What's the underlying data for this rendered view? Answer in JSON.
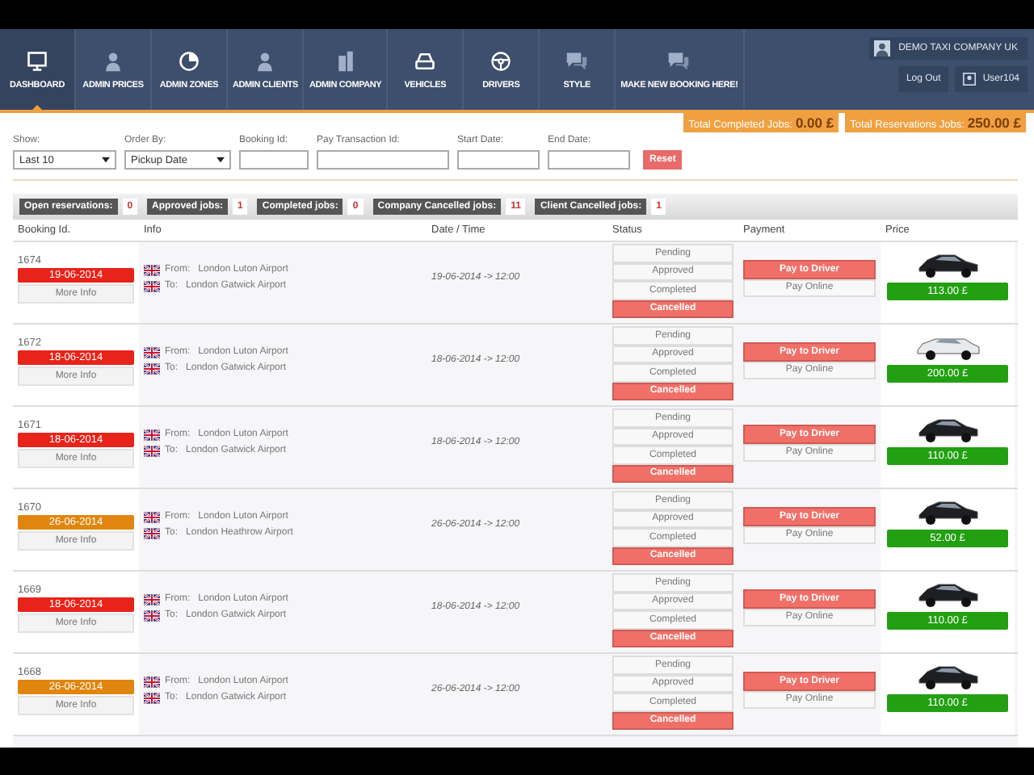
{
  "header": {
    "nav": [
      {
        "label": "DASHBOARD",
        "selected": true
      },
      {
        "label": "ADMIN PRICES",
        "selected": false
      },
      {
        "label": "ADMIN ZONES",
        "selected": false
      },
      {
        "label": "ADMIN CLIENTS",
        "selected": false
      },
      {
        "label": "ADMIN COMPANY",
        "selected": false
      },
      {
        "label": "VEHICLES",
        "selected": false
      },
      {
        "label": "DRIVERS",
        "selected": false
      },
      {
        "label": "STYLE",
        "selected": false
      },
      {
        "label": "MAKE NEW BOOKING HERE!",
        "selected": false
      }
    ],
    "company": "DEMO TAXI COMPANY UK",
    "logout": "Log Out",
    "user": "User104"
  },
  "totals": [
    {
      "label": "Total Completed Jobs:",
      "value": "0.00 £"
    },
    {
      "label": "Total Reservations Jobs:",
      "value": "250.00 £"
    }
  ],
  "filters": {
    "show": {
      "label": "Show:",
      "value": "Last 10"
    },
    "order_by": {
      "label": "Order By:",
      "value": "Pickup Date"
    },
    "booking_id": {
      "label": "Booking Id:"
    },
    "pay_transaction_id": {
      "label": "Pay Transaction Id:"
    },
    "start_date": {
      "label": "Start Date:"
    },
    "end_date": {
      "label": "End Date:"
    },
    "reset": "Reset"
  },
  "counts": [
    {
      "label": "Open reservations:",
      "value": "0"
    },
    {
      "label": "Approved jobs:",
      "value": "1"
    },
    {
      "label": "Completed jobs:",
      "value": "0"
    },
    {
      "label": "Company Cancelled jobs:",
      "value": "11"
    },
    {
      "label": "Client Cancelled jobs:",
      "value": "1"
    }
  ],
  "table": {
    "columns": [
      "Booking Id.",
      "Info",
      "Date / Time",
      "Status",
      "Payment",
      "Price"
    ],
    "rows": [
      {
        "id": "1674",
        "date": "19-06-2014",
        "color": "#e8231a",
        "more": "More Info",
        "from_label": "From:",
        "from": "London Luton Airport",
        "to_label": "To:",
        "to": "London Gatwick Airport",
        "datetime": "19-06-2014 -> 12:00",
        "statuses": [
          {
            "label": "Pending",
            "selected": false
          },
          {
            "label": "Approved",
            "selected": false
          },
          {
            "label": "Completed",
            "selected": false
          },
          {
            "label": "Cancelled",
            "selected": true
          }
        ],
        "payments": [
          {
            "label": "Pay to Driver",
            "selected": true
          },
          {
            "label": "Pay Online",
            "selected": false
          }
        ],
        "kind": "sedan",
        "price": "113.00 £"
      },
      {
        "id": "1672",
        "date": "18-06-2014",
        "color": "#e8231a",
        "more": "More Info",
        "from_label": "From:",
        "from": "London Luton Airport",
        "to_label": "To:",
        "to": "London Gatwick Airport",
        "datetime": "18-06-2014 -> 12:00",
        "statuses": [
          {
            "label": "Pending",
            "selected": false
          },
          {
            "label": "Approved",
            "selected": false
          },
          {
            "label": "Completed",
            "selected": false
          },
          {
            "label": "Cancelled",
            "selected": true
          }
        ],
        "payments": [
          {
            "label": "Pay to Driver",
            "selected": true
          },
          {
            "label": "Pay Online",
            "selected": false
          }
        ],
        "kind": "limousine",
        "price": "200.00 £"
      },
      {
        "id": "1671",
        "date": "18-06-2014",
        "color": "#e8231a",
        "more": "More Info",
        "from_label": "From:",
        "from": "London Luton Airport",
        "to_label": "To:",
        "to": "London Gatwick Airport",
        "datetime": "18-06-2014 -> 12:00",
        "statuses": [
          {
            "label": "Pending",
            "selected": false
          },
          {
            "label": "Approved",
            "selected": false
          },
          {
            "label": "Completed",
            "selected": false
          },
          {
            "label": "Cancelled",
            "selected": true
          }
        ],
        "payments": [
          {
            "label": "Pay to Driver",
            "selected": true
          },
          {
            "label": "Pay Online",
            "selected": false
          }
        ],
        "kind": "sedan",
        "price": "110.00 £"
      },
      {
        "id": "1670",
        "date": "26-06-2014",
        "color": "#e0860e",
        "more": "More Info",
        "from_label": "From:",
        "from": "London Luton Airport",
        "to_label": "To:",
        "to": "London Heathrow Airport",
        "datetime": "26-06-2014 -> 12:00",
        "statuses": [
          {
            "label": "Pending",
            "selected": false
          },
          {
            "label": "Approved",
            "selected": false
          },
          {
            "label": "Completed",
            "selected": false
          },
          {
            "label": "Cancelled",
            "selected": true
          }
        ],
        "payments": [
          {
            "label": "Pay to Driver",
            "selected": true
          },
          {
            "label": "Pay Online",
            "selected": false
          }
        ],
        "kind": "sedan",
        "price": "52.00 £"
      },
      {
        "id": "1669",
        "date": "18-06-2014",
        "color": "#e8231a",
        "more": "More Info",
        "from_label": "From:",
        "from": "London Luton Airport",
        "to_label": "To:",
        "to": "London Gatwick Airport",
        "datetime": "18-06-2014 -> 12:00",
        "statuses": [
          {
            "label": "Pending",
            "selected": false
          },
          {
            "label": "Approved",
            "selected": false
          },
          {
            "label": "Completed",
            "selected": false
          },
          {
            "label": "Cancelled",
            "selected": true
          }
        ],
        "payments": [
          {
            "label": "Pay to Driver",
            "selected": true
          },
          {
            "label": "Pay Online",
            "selected": false
          }
        ],
        "kind": "sedan",
        "price": "110.00 £"
      },
      {
        "id": "1668",
        "date": "26-06-2014",
        "color": "#e0860e",
        "more": "More Info",
        "from_label": "From:",
        "from": "London Luton Airport",
        "to_label": "To:",
        "to": "London Gatwick Airport",
        "datetime": "26-06-2014 -> 12:00",
        "statuses": [
          {
            "label": "Pending",
            "selected": false
          },
          {
            "label": "Approved",
            "selected": false
          },
          {
            "label": "Completed",
            "selected": false
          },
          {
            "label": "Cancelled",
            "selected": true
          }
        ],
        "payments": [
          {
            "label": "Pay to Driver",
            "selected": true
          },
          {
            "label": "Pay Online",
            "selected": false
          }
        ],
        "kind": "sedan",
        "price": "110.00 £"
      }
    ]
  }
}
